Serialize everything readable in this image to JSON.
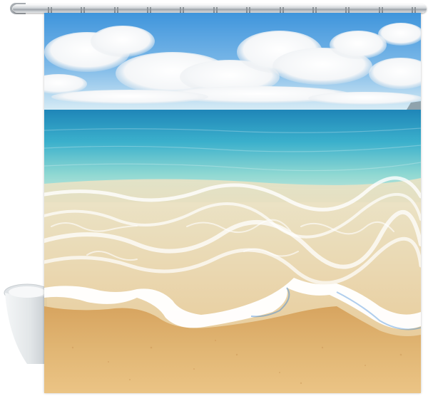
{
  "scene": {
    "subject": "shower-curtain-beach-print",
    "colors": {
      "sky_top": "#4a9fe0",
      "sky_horizon": "#cfe6f4",
      "sea_deep": "#2f9fc4",
      "sea_shallow": "#7fd3d0",
      "foam": "#ffffff",
      "sand": "#dcae6a",
      "sand_dark": "#c8934d",
      "rod": "#b8bdc2"
    },
    "hook_count": 12
  }
}
